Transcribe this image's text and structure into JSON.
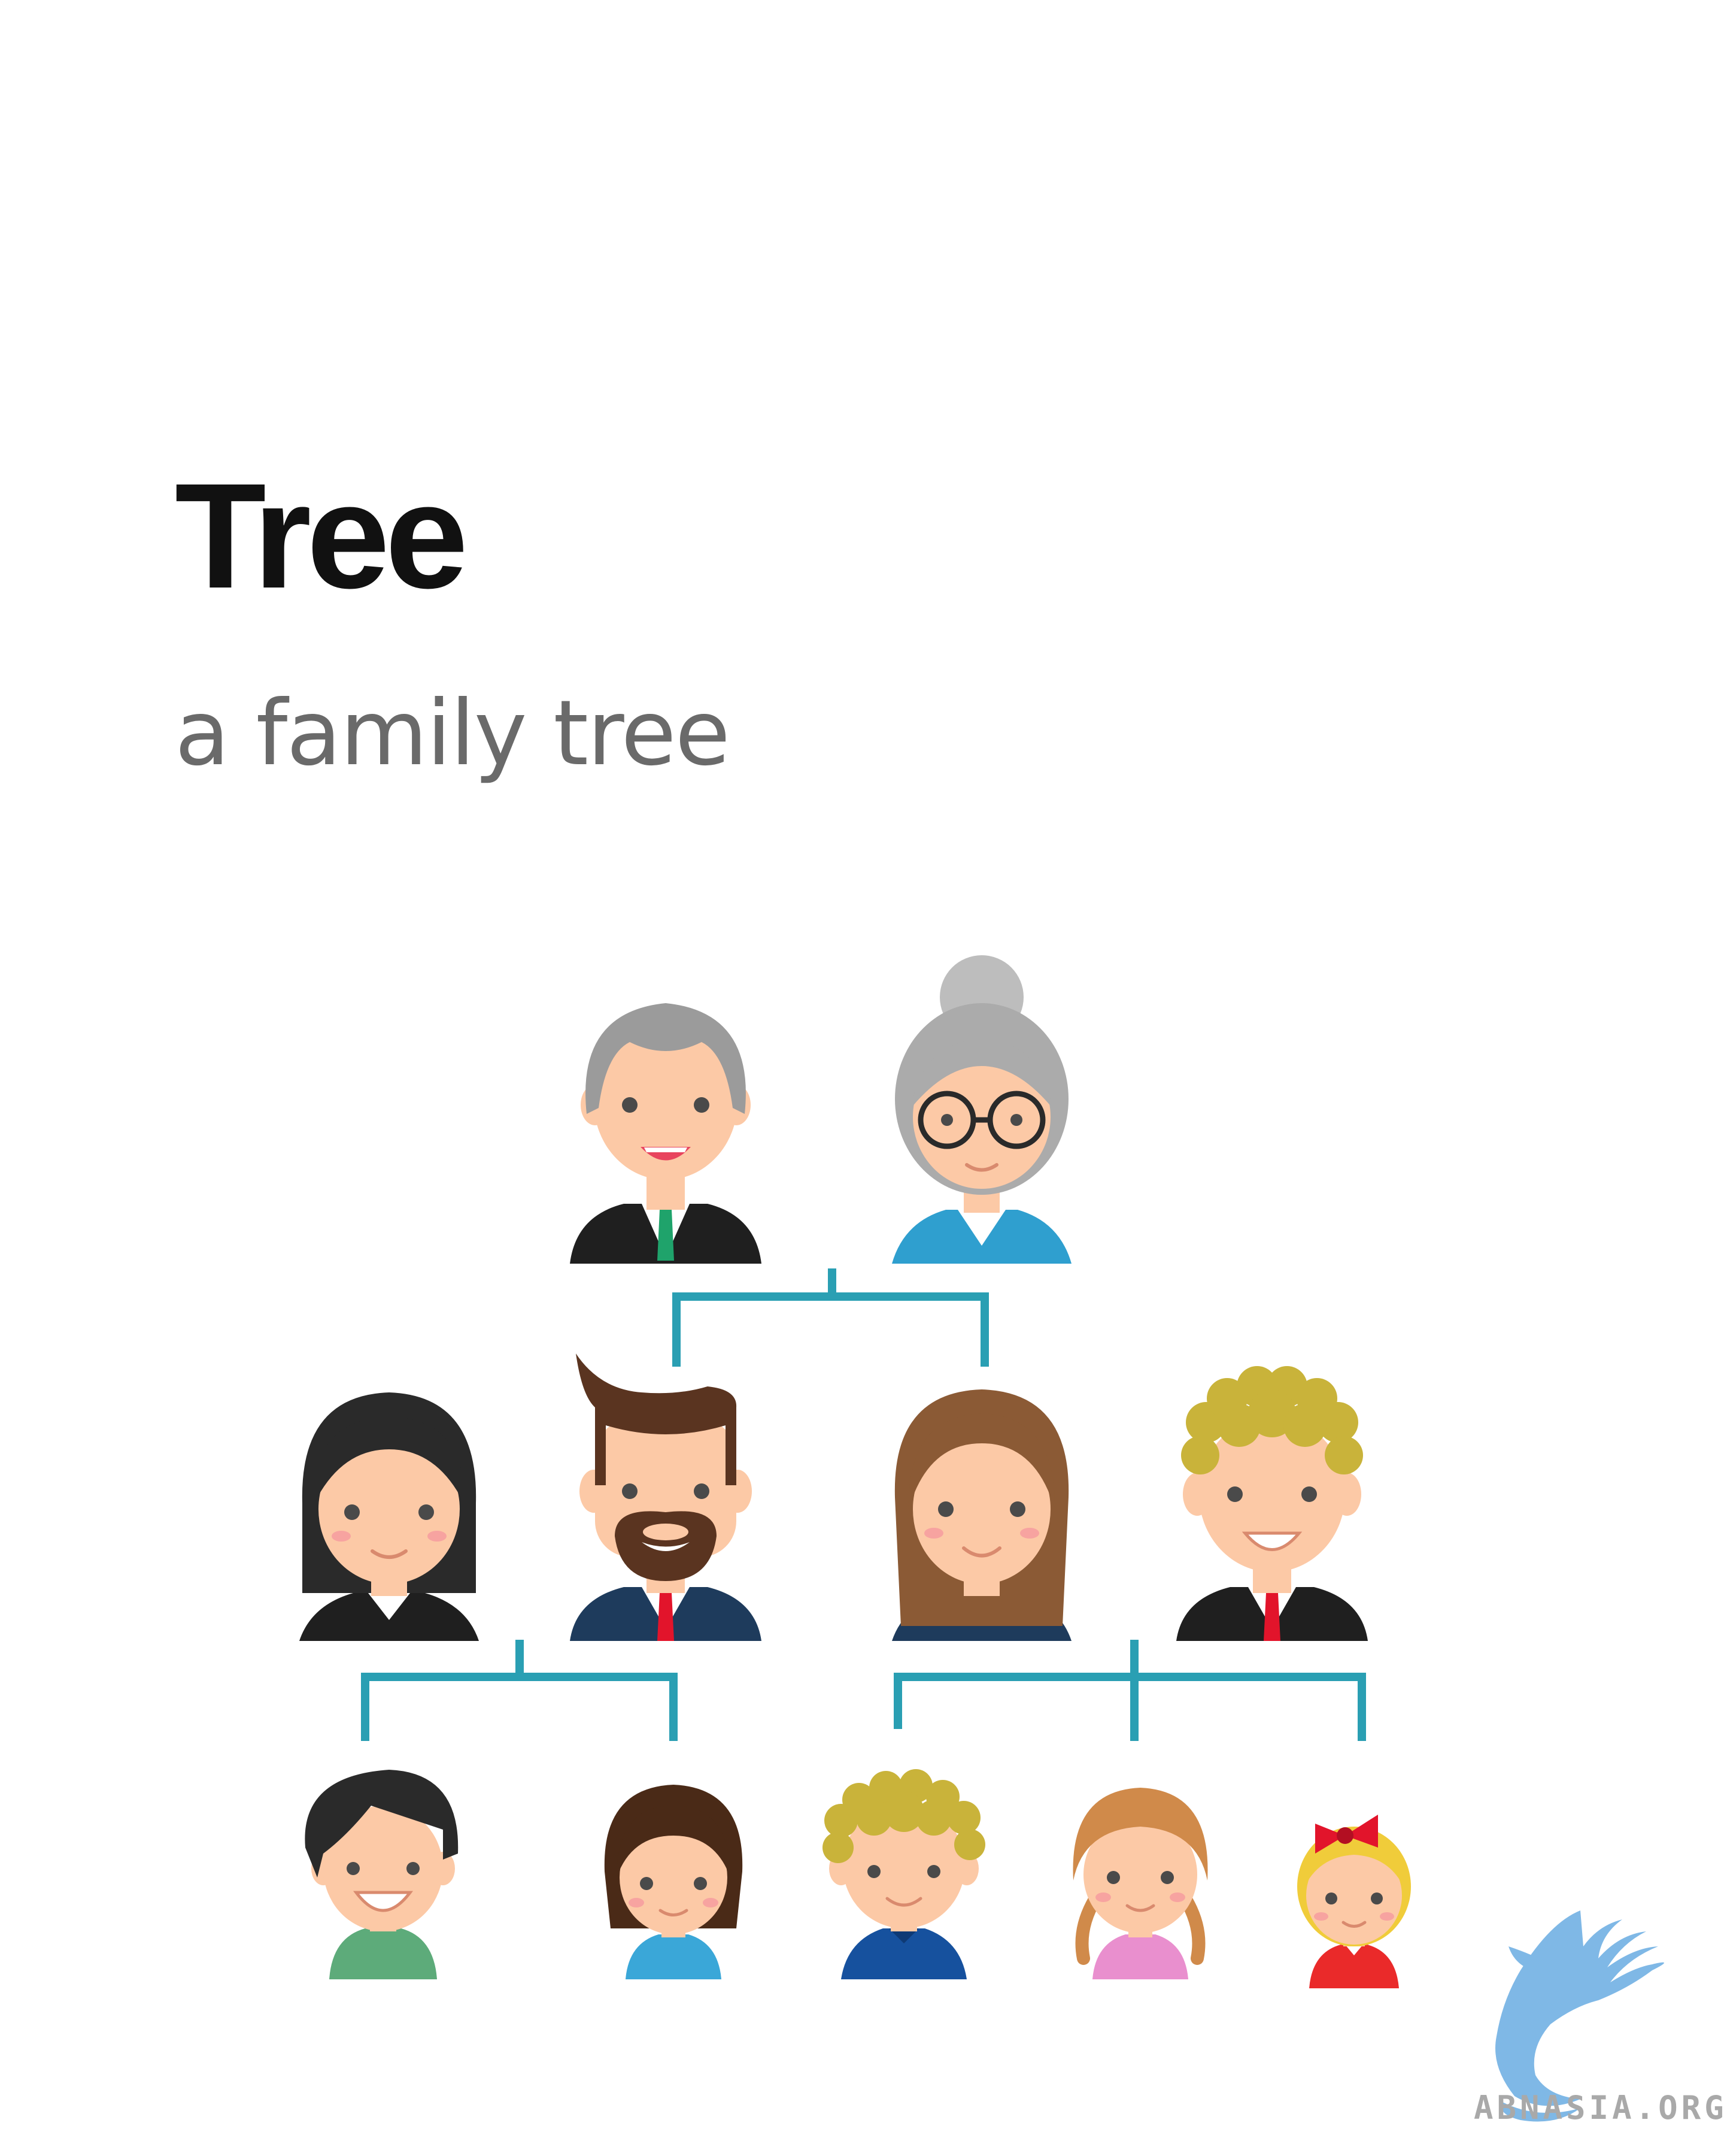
{
  "heading": {
    "title": "Tree",
    "subtitle": "a family tree"
  },
  "watermark": {
    "text": "ABNASIA.ORG"
  },
  "colors": {
    "connector": "#2a9fb3",
    "skin": "#fcc9a6",
    "grey_hair": "#9b9b9b",
    "dark_hair": "#2a2a2a",
    "brown_hair": "#6b4226",
    "blond_curly": "#c9b33a",
    "suit_dark": "#1f1f1f",
    "suit_navy": "#1e3b5c",
    "tie_red": "#e2142b",
    "tie_green": "#1fa36b",
    "watermark_blue": "#7fb8e6"
  },
  "generations": [
    {
      "level": 1,
      "members": [
        "grandfather",
        "grandmother"
      ]
    },
    {
      "level": 2,
      "members": [
        "aunt",
        "father",
        "mother",
        "uncle"
      ]
    },
    {
      "level": 3,
      "members": [
        "son",
        "daughter",
        "boy-curly",
        "girl-pigtails",
        "girl-bow"
      ]
    }
  ]
}
